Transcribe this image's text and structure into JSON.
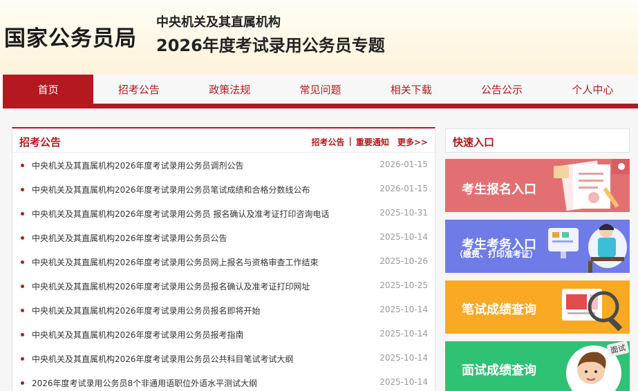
{
  "header": {
    "logo": "国家公务员局",
    "subtitle1": "中央机关及其直属机构",
    "subtitle2": "2026年度考试录用公务员专题"
  },
  "nav": [
    {
      "label": "首页"
    },
    {
      "label": "招考公告"
    },
    {
      "label": "政策法规"
    },
    {
      "label": "常见问题"
    },
    {
      "label": "相关下载"
    },
    {
      "label": "公告公示"
    },
    {
      "label": "个人中心"
    }
  ],
  "notice": {
    "title": "招考公告",
    "link1": "招考公告",
    "sep": "|",
    "link2": "重要通知",
    "more": "更多>>",
    "items": [
      {
        "title": "中央机关及其直属机构2026年度考试录用公务员调剂公告",
        "date": "2026-01-15"
      },
      {
        "title": "中央机关及其直属机构2026年度考试录用公务员笔试成绩和合格分数线公布",
        "date": "2026-01-15"
      },
      {
        "title": "中央机关及其直属机构2026年度考试录用公务员 报名确认及准考证打印咨询电话",
        "date": "2025-10-31"
      },
      {
        "title": "中央机关及其直属机构2026年度考试录用公务员公告",
        "date": "2025-10-14"
      },
      {
        "title": "中央机关及其直属机构2026年度考试录用公务员网上报名与资格审查工作结束",
        "date": "2025-10-26"
      },
      {
        "title": "中央机关及其直属机构2026年度考试录用公务员报名确认及准考证打印网址",
        "date": "2025-10-25"
      },
      {
        "title": "中央机关及其直属机构2026年度考试录用公务员报名即将开始",
        "date": "2025-10-14"
      },
      {
        "title": "中央机关及其直属机构2026年度考试录用公务员报考指南",
        "date": "2025-10-14"
      },
      {
        "title": "中央机关及其直属机构2026年度考试录用公务员公共科目笔试考试大纲",
        "date": "2025-10-14"
      },
      {
        "title": "2026年度考试录用公务员8个非通用语职位外语水平测试大纲",
        "date": "2025-10-14"
      }
    ]
  },
  "quick": {
    "title": "快速入口",
    "cards": [
      {
        "label": "考生报名入口",
        "note": "",
        "color": "#e27072"
      },
      {
        "label": "考生考务入口",
        "note": "（缴费、打印准考证）",
        "color": "#6f7be6"
      },
      {
        "label": "笔试成绩查询",
        "note": "",
        "color": "#f9a923"
      },
      {
        "label": "面试成绩查询",
        "note": "",
        "color": "#2fc174",
        "badge": "面试"
      }
    ]
  }
}
